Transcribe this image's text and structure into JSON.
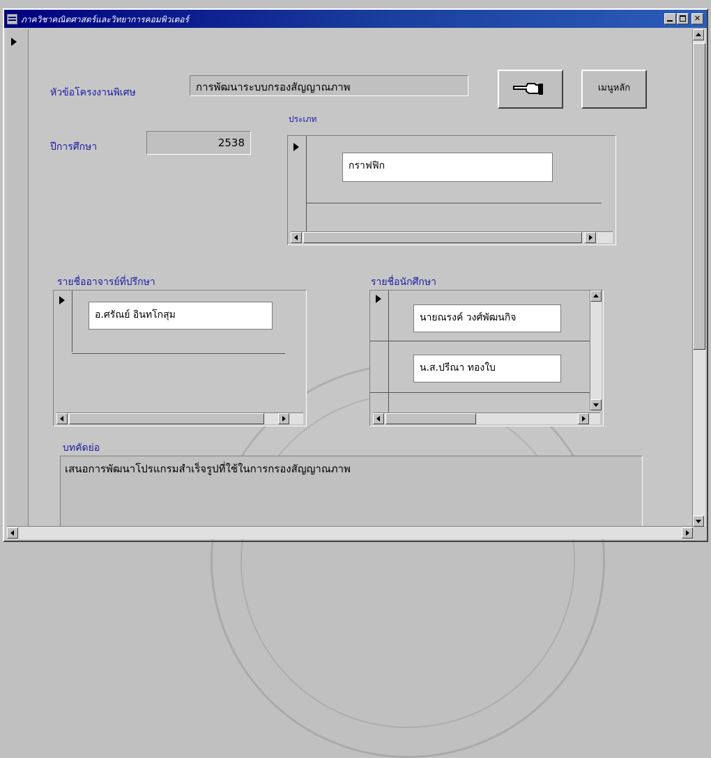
{
  "window": {
    "title": "ภาควิชาคณิตศาสตร์และวิทยาการคอมพิวเตอร์"
  },
  "form": {
    "project_label": "หัวข้อโครงงานพิเศษ",
    "project_value": "การพัฒนาระบบกรองสัญญาณภาพ",
    "year_label": "ปีการศึกษา",
    "year_value": "2538",
    "category_label": "ประเภท",
    "category_value": "กราฟฟิก",
    "advisor_label": "รายชื่ออาจารย์ที่ปรึกษา",
    "advisor_value": "อ.ศรัณย์ อินทโกสุม",
    "students_label": "รายชื่อนักศึกษา",
    "students": [
      "นายณรงค์  วงศ์พัฒนกิจ",
      "น.ส.ปรีณา  ทองใบ"
    ],
    "abstract_label": "บทคัดย่อ",
    "abstract_value": "เสนอการพัฒนาโปรแกรมสำเร็จรูปที่ใช้ในการกรองสัญญาณภาพ"
  },
  "buttons": {
    "main_menu_label": "เมนูหลัก",
    "pointer_icon": "hand-pointing-left-icon"
  }
}
